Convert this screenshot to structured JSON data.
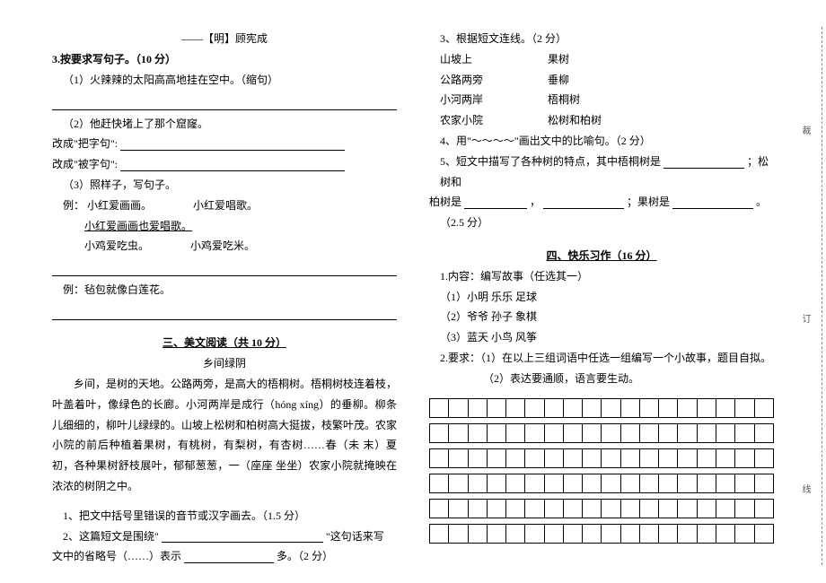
{
  "left": {
    "attribution": "——【明】顾宪成",
    "q3_header": "3.按要求写句子。（10 分）",
    "q3_1": "（1）火辣辣的太阳高高地挂在空中。（缩句）",
    "q3_2": "（2）他赶快堵上了那个窟窿。",
    "q3_2_ba": "改成\"把字句\":",
    "q3_2_bei": "改成\"被字句\":",
    "q3_3": "（3）照样子，写句子。",
    "q3_3_ex_prefix": "例：",
    "q3_3_ex_a": "小红爱画画。",
    "q3_3_ex_b": "小红爱唱歌。",
    "q3_3_ex_merge": "小红爱画画也爱唱歌。",
    "q3_3_line_a": "小鸡爱吃虫。",
    "q3_3_line_b": "小鸡爱吃米。",
    "q3_3_ex2": "例：毡包就像白莲花。",
    "sec3_title": "三、美文阅读（共 10 分）",
    "passage_title": "乡间绿阴",
    "passage_text": "乡间，是树的天地。公路两旁，是高大的梧桐树。梧桐树枝连着枝，叶盖着叶，像绿色的长廊。小河两岸是成行（hóng  xíng）的垂柳。柳条儿细细的，柳叶儿绿绿的。山坡上松树和柏树高大挺拔，枝繁叶茂。农家小院的前后种植着果树，有桃树，有梨树，有杏树……春（未  末）夏初，各种果树舒枝展叶，郁郁葱葱，一（座座  坐坐）农家小院就掩映在浓浓的树阴之中。",
    "p_q1": "1、把文中括号里错误的音节或汉字画去。（1.5 分）",
    "p_q2a": "2、这篇短文是围绕\"",
    "p_q2b": "\"这句话来写",
    "p_q2c": "文中的省略号（……）表示",
    "p_q2d": "多。（2 分）"
  },
  "right": {
    "p_q3": "3、根据短文连线。（2 分）",
    "rows": [
      {
        "l": "山坡上",
        "r": "果树"
      },
      {
        "l": "公路两旁",
        "r": "垂柳"
      },
      {
        "l": "小河两岸",
        "r": "梧桐树"
      },
      {
        "l": "农家小院",
        "r": "松树和柏树"
      }
    ],
    "p_q4": "4、用\"～～～～\"画出文中的比喻句。（2 分）",
    "p_q5a": "5、短文中描写了各种树的特点，其中梧桐树是",
    "p_q5b": "；松树和",
    "p_q5c_pre": "柏树是",
    "p_q5c_mid": "，",
    "p_q5c_end": "；果树是",
    "p_q5c_tail": "。",
    "p_q5_pts": "（2.5 分）",
    "sec4_title": "四、快乐习作（16 分）",
    "w1": "1.内容：编写故事（任选其一）",
    "w_opts": [
      "（1）小明    乐乐    足球",
      "（2）爷爷    孙子    象棋",
      "（3）蓝天    小鸟    风筝"
    ],
    "w2a": "2.要求：（1）在以上三组词语中任选一组编写一个小故事，题目自拟。",
    "w2b": "（2）表达要通顺，语言要生动。"
  },
  "side": {
    "a": "裁",
    "b": "订",
    "c": "线"
  }
}
